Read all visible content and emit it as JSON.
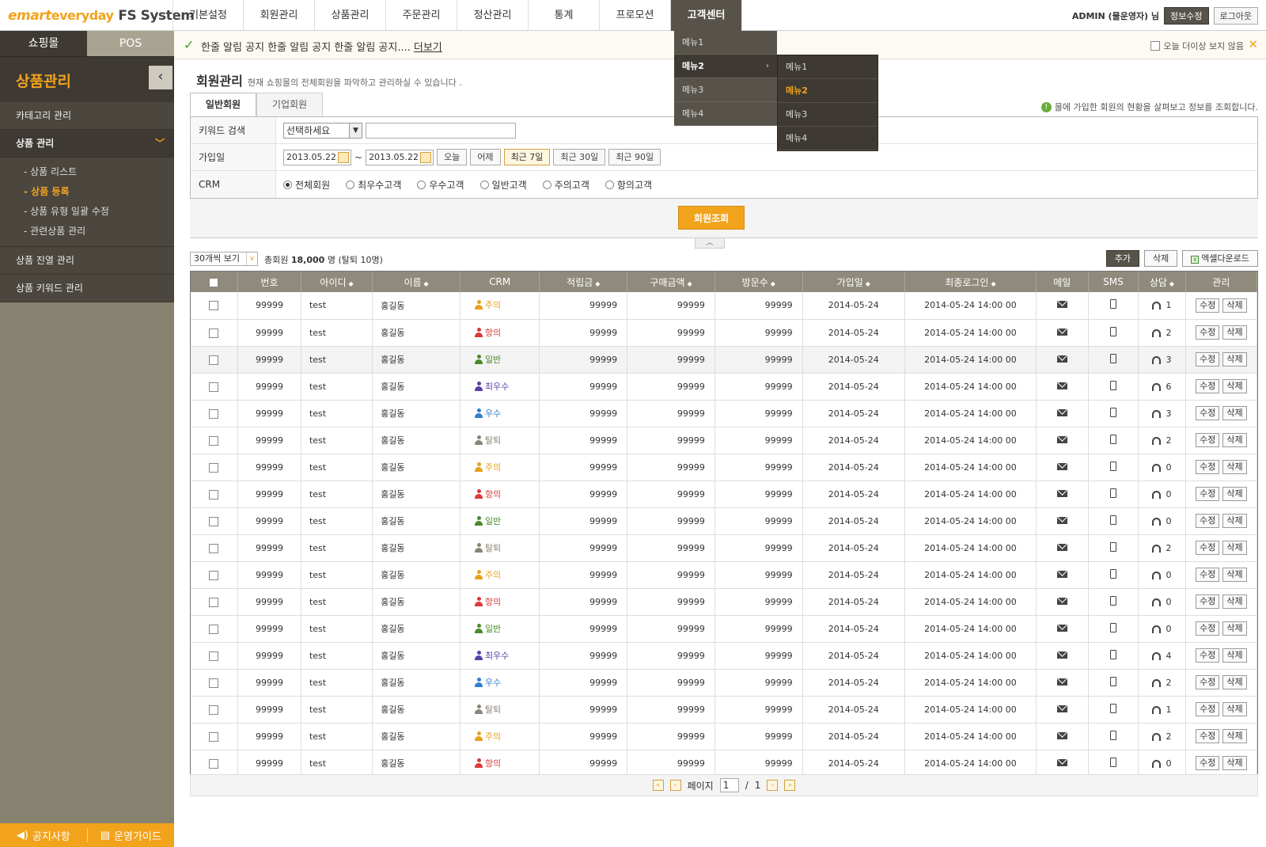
{
  "header": {
    "logo_e": "e",
    "logo_mart": "mart",
    "logo_everyday": "everyday",
    "logo_fs": "FS System",
    "nav": [
      "기본설정",
      "회원관리",
      "상품관리",
      "주문관리",
      "정산관리",
      "통계",
      "프로모션",
      "고객센터"
    ],
    "user": "ADMIN (물운영자) 님",
    "edit_info": "정보수정",
    "logout": "로그아웃"
  },
  "gnb_dropdown": {
    "items": [
      "메뉴1",
      "메뉴2",
      "메뉴3",
      "메뉴4"
    ],
    "submenu": [
      "메뉴1",
      "메뉴2",
      "메뉴3",
      "메뉴4"
    ]
  },
  "sidebar": {
    "tabs": [
      "쇼핑몰",
      "POS"
    ],
    "title": "상품관리",
    "items": [
      "카테고리 관리",
      "상품 관리",
      "상품 진열 관리",
      "상품 키워드 관리"
    ],
    "sub_items": [
      "- 상품 리스트",
      "- 상품 등록",
      "- 상품 유형 일괄 수정",
      "- 관련상품 관리"
    ],
    "footer_notice": "공지사항",
    "footer_guide": "운영가이드"
  },
  "notice": {
    "text": "한줄 알림 공지 한줄 알림 공지 한줄 알림 공지....",
    "more": "더보기",
    "hide_today": "오늘 더이상 보지 않음"
  },
  "page": {
    "title": "회원관리",
    "desc": "현재 쇼핑몰의 전체회원을 파악하고 관리하실 수 있습니다 .",
    "tabs": [
      "일반회원",
      "기업회원"
    ],
    "tab_note": "몰에 가입한 회원의 현황을 살펴보고 정보를 조회합니다."
  },
  "search": {
    "keyword_label": "키워드 검색",
    "keyword_select": "선택하세요",
    "join_label": "가입일",
    "date_from": "2013.05.22",
    "date_to": "2013.05.22",
    "tilde": "~",
    "date_buttons": [
      "오늘",
      "어제",
      "최근 7일",
      "최근 30일",
      "최근 90일"
    ],
    "crm_label": "CRM",
    "crm_options": [
      "전체회원",
      "최우수고객",
      "우수고객",
      "일반고객",
      "주의고객",
      "항의고객"
    ],
    "submit": "회원조회"
  },
  "toolbar": {
    "view": "30개씩 보기",
    "total_prefix": "총회원",
    "total_count": "18,000",
    "total_suffix": "명 (탈퇴 10명)",
    "add": "추가",
    "delete": "삭제",
    "excel": "엑셀다운로드"
  },
  "table": {
    "headers": [
      "번호",
      "아이디",
      "이름",
      "CRM",
      "적립금",
      "구매금액",
      "방문수",
      "가입일",
      "최종로그인",
      "메일",
      "SMS",
      "상담",
      "관리"
    ],
    "edit": "수정",
    "del": "삭제",
    "rows": [
      {
        "no": "99999",
        "id": "test",
        "name": "홍길동",
        "crm": "주의",
        "c": "#e8a01a",
        "point": "99999",
        "amount": "99999",
        "visit": "99999",
        "join": "2014-05-24",
        "last": "2014-05-24 14:00 00",
        "consult": "1"
      },
      {
        "no": "99999",
        "id": "test",
        "name": "홍길동",
        "crm": "항의",
        "c": "#d93a3a",
        "point": "99999",
        "amount": "99999",
        "visit": "99999",
        "join": "2014-05-24",
        "last": "2014-05-24 14:00 00",
        "consult": "2"
      },
      {
        "no": "99999",
        "id": "test",
        "name": "홍길동",
        "crm": "일반",
        "c": "#4a8a2a",
        "point": "99999",
        "amount": "99999",
        "visit": "99999",
        "join": "2014-05-24",
        "last": "2014-05-24 14:00 00",
        "consult": "3"
      },
      {
        "no": "99999",
        "id": "test",
        "name": "홍길동",
        "crm": "최우수",
        "c": "#5a3fa8",
        "point": "99999",
        "amount": "99999",
        "visit": "99999",
        "join": "2014-05-24",
        "last": "2014-05-24 14:00 00",
        "consult": "6"
      },
      {
        "no": "99999",
        "id": "test",
        "name": "홍길동",
        "crm": "우수",
        "c": "#2f7fd1",
        "point": "99999",
        "amount": "99999",
        "visit": "99999",
        "join": "2014-05-24",
        "last": "2014-05-24 14:00 00",
        "consult": "3"
      },
      {
        "no": "99999",
        "id": "test",
        "name": "홍길동",
        "crm": "탈퇴",
        "c": "#8a8576",
        "point": "99999",
        "amount": "99999",
        "visit": "99999",
        "join": "2014-05-24",
        "last": "2014-05-24 14:00 00",
        "consult": "2"
      },
      {
        "no": "99999",
        "id": "test",
        "name": "홍길동",
        "crm": "주의",
        "c": "#e8a01a",
        "point": "99999",
        "amount": "99999",
        "visit": "99999",
        "join": "2014-05-24",
        "last": "2014-05-24 14:00 00",
        "consult": "0"
      },
      {
        "no": "99999",
        "id": "test",
        "name": "홍길동",
        "crm": "항의",
        "c": "#d93a3a",
        "point": "99999",
        "amount": "99999",
        "visit": "99999",
        "join": "2014-05-24",
        "last": "2014-05-24 14:00 00",
        "consult": "0"
      },
      {
        "no": "99999",
        "id": "test",
        "name": "홍길동",
        "crm": "일반",
        "c": "#4a8a2a",
        "point": "99999",
        "amount": "99999",
        "visit": "99999",
        "join": "2014-05-24",
        "last": "2014-05-24 14:00 00",
        "consult": "0"
      },
      {
        "no": "99999",
        "id": "test",
        "name": "홍길동",
        "crm": "탈퇴",
        "c": "#8a8576",
        "point": "99999",
        "amount": "99999",
        "visit": "99999",
        "join": "2014-05-24",
        "last": "2014-05-24 14:00 00",
        "consult": "2"
      },
      {
        "no": "99999",
        "id": "test",
        "name": "홍길동",
        "crm": "주의",
        "c": "#e8a01a",
        "point": "99999",
        "amount": "99999",
        "visit": "99999",
        "join": "2014-05-24",
        "last": "2014-05-24 14:00 00",
        "consult": "0"
      },
      {
        "no": "99999",
        "id": "test",
        "name": "홍길동",
        "crm": "항의",
        "c": "#d93a3a",
        "point": "99999",
        "amount": "99999",
        "visit": "99999",
        "join": "2014-05-24",
        "last": "2014-05-24 14:00 00",
        "consult": "0"
      },
      {
        "no": "99999",
        "id": "test",
        "name": "홍길동",
        "crm": "일반",
        "c": "#4a8a2a",
        "point": "99999",
        "amount": "99999",
        "visit": "99999",
        "join": "2014-05-24",
        "last": "2014-05-24 14:00 00",
        "consult": "0"
      },
      {
        "no": "99999",
        "id": "test",
        "name": "홍길동",
        "crm": "최우수",
        "c": "#5a3fa8",
        "point": "99999",
        "amount": "99999",
        "visit": "99999",
        "join": "2014-05-24",
        "last": "2014-05-24 14:00 00",
        "consult": "4"
      },
      {
        "no": "99999",
        "id": "test",
        "name": "홍길동",
        "crm": "우수",
        "c": "#2f7fd1",
        "point": "99999",
        "amount": "99999",
        "visit": "99999",
        "join": "2014-05-24",
        "last": "2014-05-24 14:00 00",
        "consult": "2"
      },
      {
        "no": "99999",
        "id": "test",
        "name": "홍길동",
        "crm": "탈퇴",
        "c": "#8a8576",
        "point": "99999",
        "amount": "99999",
        "visit": "99999",
        "join": "2014-05-24",
        "last": "2014-05-24 14:00 00",
        "consult": "1"
      },
      {
        "no": "99999",
        "id": "test",
        "name": "홍길동",
        "crm": "주의",
        "c": "#e8a01a",
        "point": "99999",
        "amount": "99999",
        "visit": "99999",
        "join": "2014-05-24",
        "last": "2014-05-24 14:00 00",
        "consult": "2"
      },
      {
        "no": "99999",
        "id": "test",
        "name": "홍길동",
        "crm": "항의",
        "c": "#d93a3a",
        "point": "99999",
        "amount": "99999",
        "visit": "99999",
        "join": "2014-05-24",
        "last": "2014-05-24 14:00 00",
        "consult": "0"
      }
    ]
  },
  "pager": {
    "label": "페이지",
    "current": "1",
    "slash": "/",
    "total": "1"
  },
  "colors": {
    "accent": "#f2a31c",
    "dark": "#58534a",
    "sidebar_bg": "#87816f"
  }
}
